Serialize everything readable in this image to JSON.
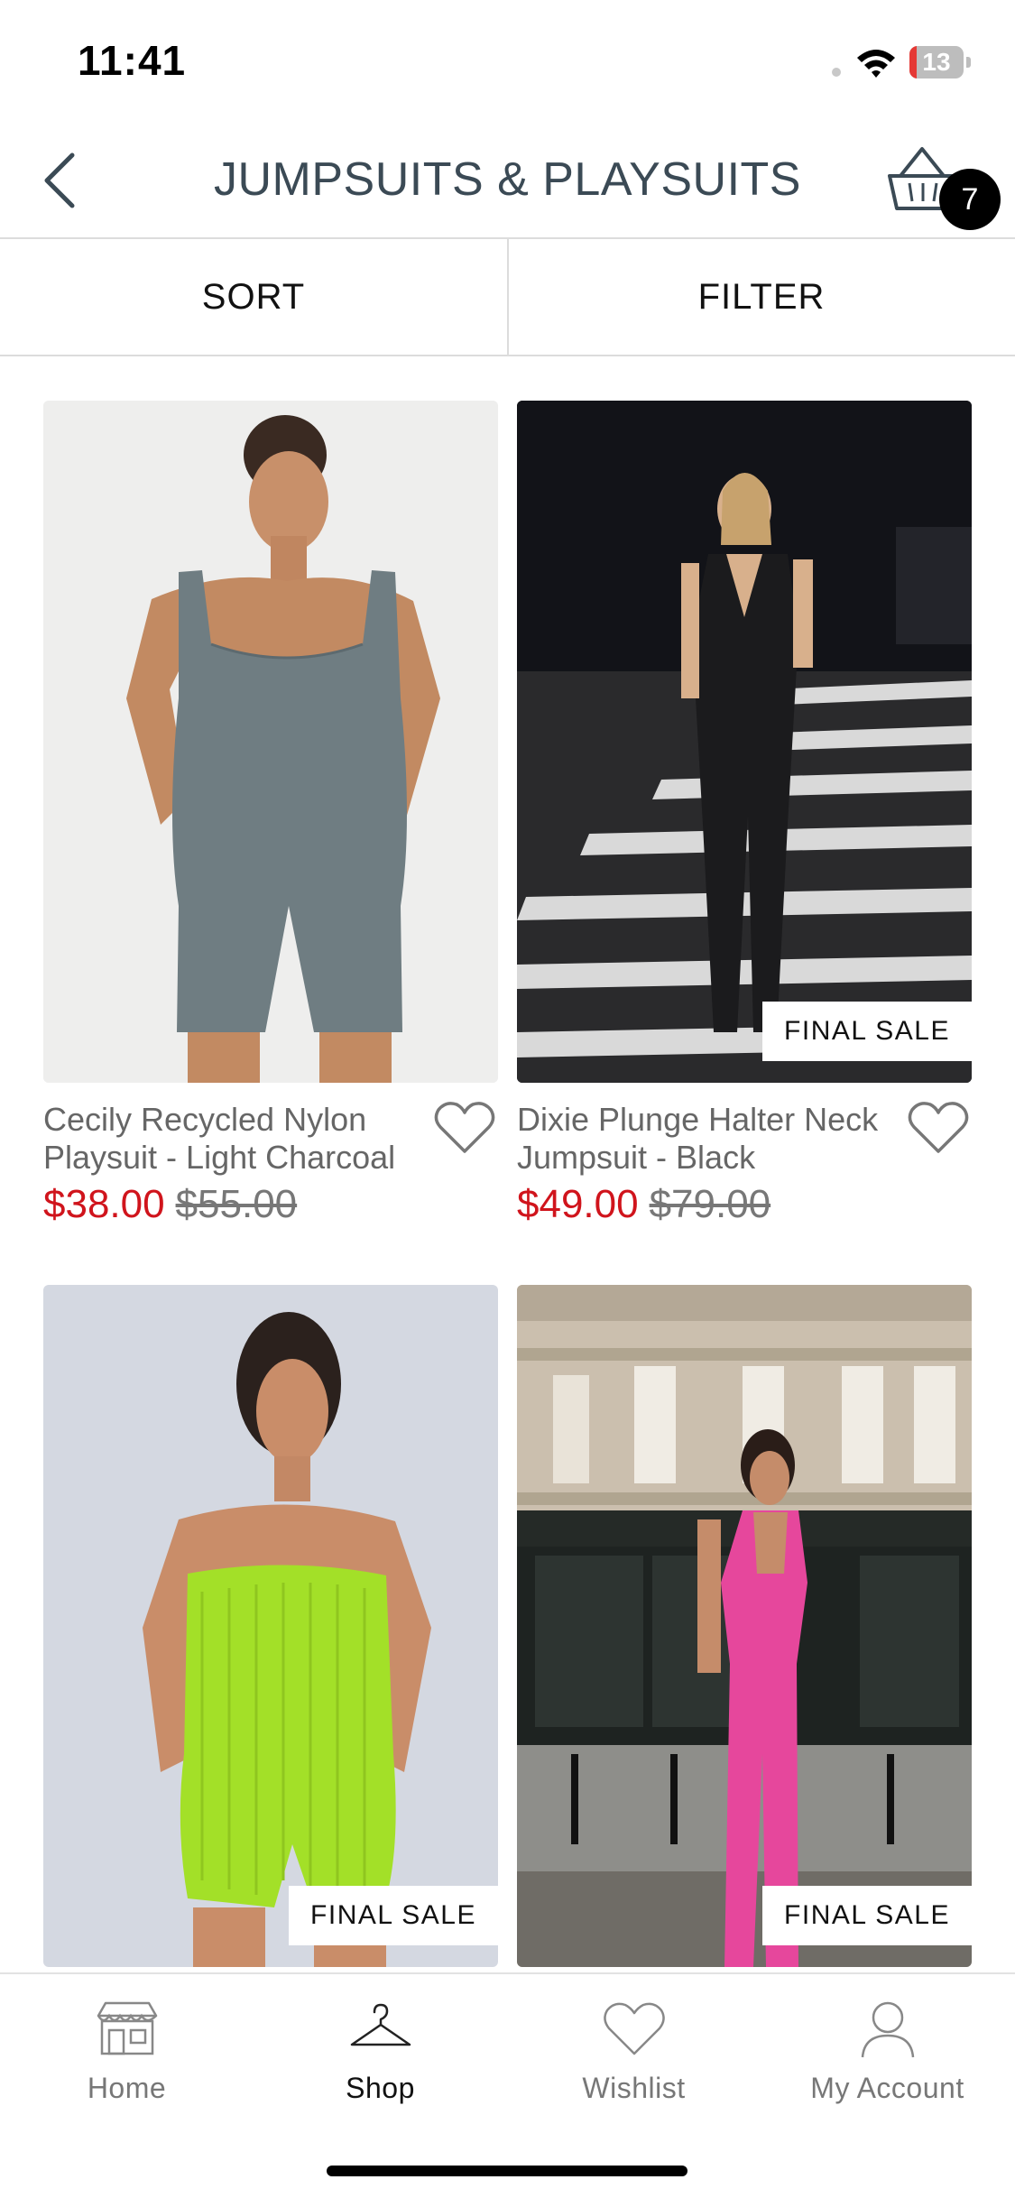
{
  "status_bar": {
    "time": "11:41",
    "battery_level": "13",
    "battery_fraction": 0.13
  },
  "header": {
    "title": "JUMPSUITS & PLAYSUITS",
    "back_icon": "chevron-left-icon",
    "cart_icon": "basket-icon",
    "cart_count": "7"
  },
  "toolbar": {
    "sort_label": "SORT",
    "filter_label": "FILTER"
  },
  "products": [
    {
      "name": "Cecily Recycled Nylon Playsuit - Light Charcoal",
      "price": "$38.00",
      "original_price": "$55.00",
      "badge": ""
    },
    {
      "name": "Dixie Plunge Halter Neck Jumpsuit - Black",
      "price": "$49.00",
      "original_price": "$79.00",
      "badge": "FINAL SALE"
    },
    {
      "name": "",
      "price": "",
      "original_price": "",
      "badge": "FINAL SALE"
    },
    {
      "name": "",
      "price": "",
      "original_price": "",
      "badge": "FINAL SALE"
    }
  ],
  "tab_bar": {
    "items": [
      {
        "label": "Home",
        "icon": "storefront-icon",
        "active": false
      },
      {
        "label": "Shop",
        "icon": "hanger-icon",
        "active": true
      },
      {
        "label": "Wishlist",
        "icon": "heart-icon",
        "active": false
      },
      {
        "label": "My Account",
        "icon": "person-icon",
        "active": false
      }
    ]
  },
  "colors": {
    "sale_red": "#d0141c",
    "title_slate": "#3b4a55",
    "badge_black": "#000000"
  }
}
